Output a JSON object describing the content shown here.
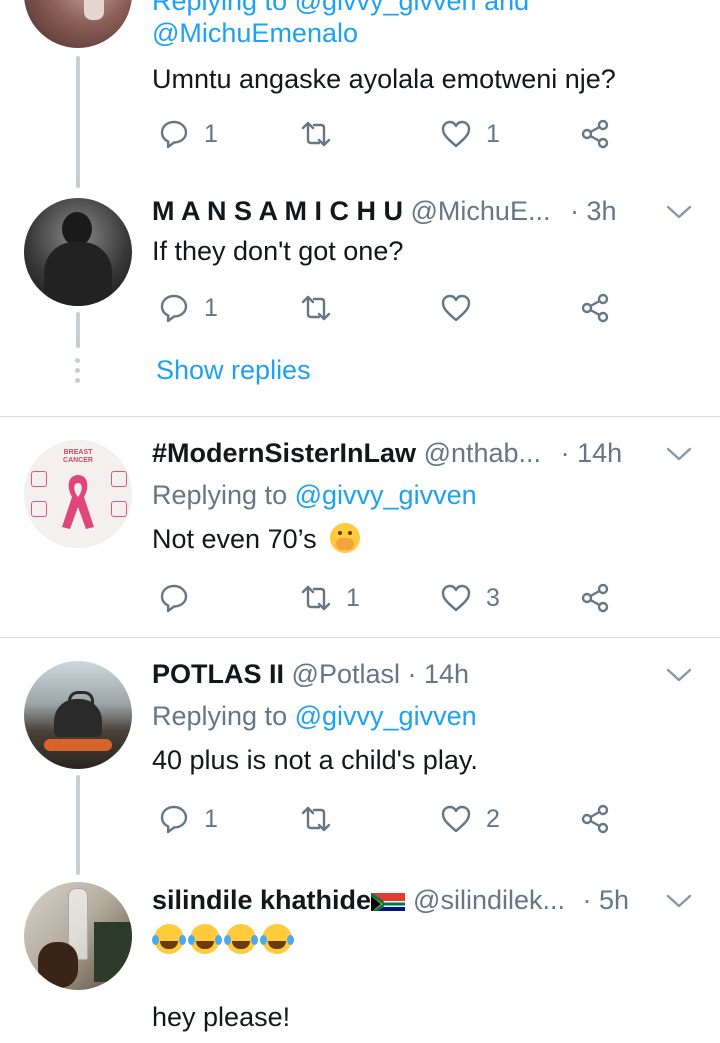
{
  "tweets": [
    {
      "reply_to_partial": "Replying to @givvy_givven and",
      "mention": "@MichuEmenalo",
      "text": "Umntu angaske ayolala emotweni nje?",
      "actions": {
        "reply": "1",
        "retweet": "",
        "like": "1"
      }
    },
    {
      "name": "M A N S A M I C H U",
      "handle": "@MichuE...",
      "time": "· 3h",
      "text": "If they don't got one?",
      "actions": {
        "reply": "1",
        "retweet": "",
        "like": ""
      },
      "show_replies": "Show replies"
    },
    {
      "name": "#ModernSisterInLaw",
      "handle": "@nthab...",
      "time": "· 14h",
      "replying_prefix": "Replying to",
      "replying_user": "@givvy_givven",
      "text": "Not even 70’s",
      "actions": {
        "reply": "",
        "retweet": "1",
        "like": "3"
      },
      "avatar_text": {
        "line1": "BREAST",
        "line2": "CANCER"
      }
    },
    {
      "name": "POTLAS II",
      "handle": "@Potlasl",
      "time": "· 14h",
      "replying_prefix": "Replying to",
      "replying_user": "@givvy_givven",
      "text": "40 plus is not a child's play.",
      "actions": {
        "reply": "1",
        "retweet": "",
        "like": "2"
      }
    },
    {
      "name": "silindile khathide",
      "handle": "@silindilek...",
      "time": "· 5h",
      "emoji_text": "😂😂😂😂",
      "text": "hey please!"
    }
  ],
  "colors": {
    "link": "#1da1f2",
    "muted": "#657786",
    "thread_line": "#c4cfd6"
  }
}
